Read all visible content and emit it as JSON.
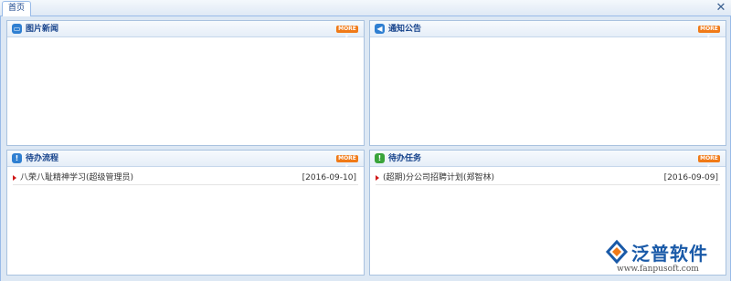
{
  "tabbar": {
    "active_tab": "首页",
    "close_symbol": "✕"
  },
  "panels": {
    "news": {
      "title": "图片新闻",
      "icon": "image-icon",
      "more_label": "MORE ▸",
      "rows": []
    },
    "notice": {
      "title": "通知公告",
      "icon": "speaker-icon",
      "more_label": "MORE ▸",
      "rows": []
    },
    "process": {
      "title": "待办流程",
      "icon": "alert-icon",
      "more_label": "MORE ▸",
      "rows": [
        {
          "text": "八荣八耻精神学习(超级管理员)",
          "date": "[2016-09-10]"
        }
      ]
    },
    "task": {
      "title": "待办任务",
      "icon": "task-icon",
      "more_label": "MORE ▸",
      "rows": [
        {
          "text": "(超期)分公司招聘计划(郑智林)",
          "date": "[2016-09-09]"
        }
      ]
    }
  },
  "logo": {
    "name": "泛普软件",
    "url": "www.fanpusoft.com"
  },
  "colors": {
    "accent": "#15428b",
    "more": "#f07a18",
    "arrow": "#d01818"
  }
}
